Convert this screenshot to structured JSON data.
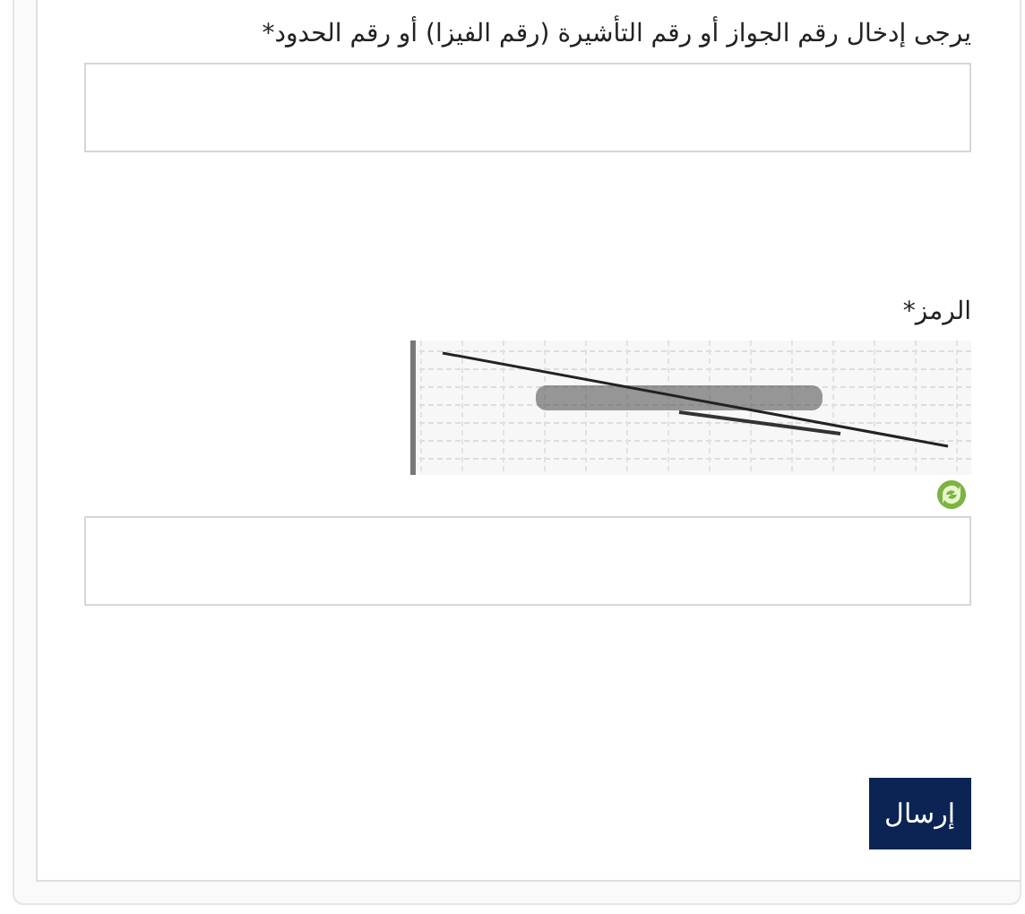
{
  "form": {
    "fields": [
      {
        "label": "يرجى إدخال رقم الجواز أو رقم التأشيرة (رقم الفيزا) أو رقم الحدود*",
        "kind": "text"
      },
      {
        "label": "الرمز*",
        "kind": "captcha"
      }
    ],
    "submit_button": "إرسال"
  }
}
